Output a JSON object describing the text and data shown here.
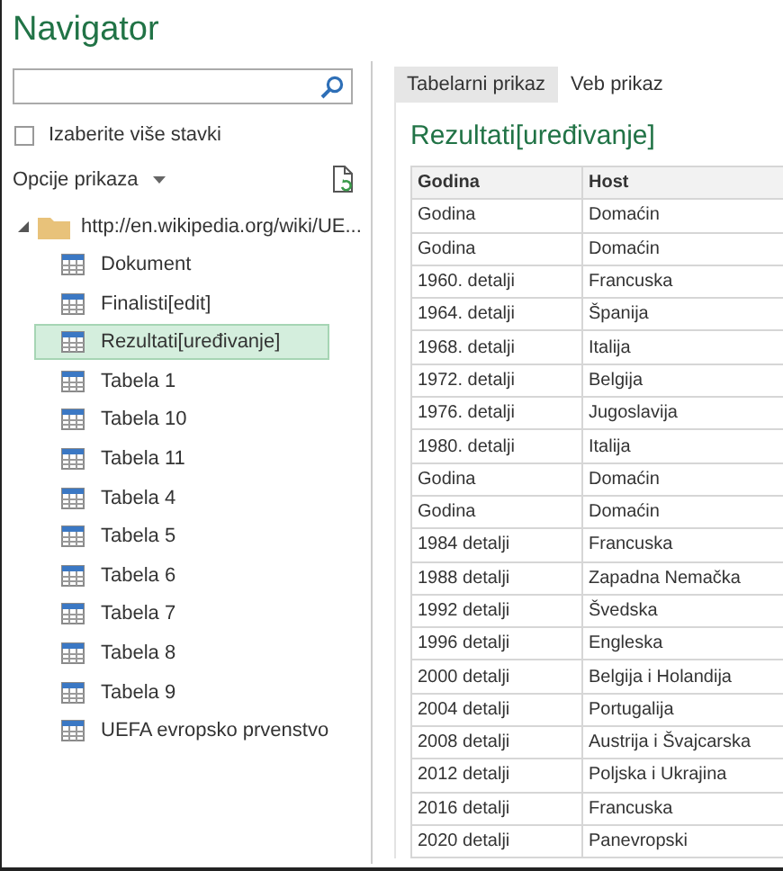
{
  "window": {
    "title": "Navigator"
  },
  "multi_select": {
    "label": "Izaberite više stavki",
    "checked": false
  },
  "view_options": {
    "label": "Opcije prikaza"
  },
  "tree": [
    {
      "label": "http://en.wikipedia.org/wiki/UE...",
      "expanded": true,
      "children": [
        {
          "label": "Dokument",
          "selected": false
        },
        {
          "label": "Finalisti[edit]",
          "selected": false
        },
        {
          "label": "Rezultati[uređivanje]",
          "selected": true
        },
        {
          "label": "Tabela 1",
          "selected": false
        },
        {
          "label": "Tabela 10",
          "selected": false
        },
        {
          "label": "Tabela 11",
          "selected": false
        },
        {
          "label": "Tabela 4",
          "selected": false
        },
        {
          "label": "Tabela 5",
          "selected": false
        },
        {
          "label": "Tabela 6",
          "selected": false
        },
        {
          "label": "Tabela 7",
          "selected": false
        },
        {
          "label": "Tabela 8",
          "selected": false
        },
        {
          "label": "Tabela 9",
          "selected": false
        },
        {
          "label": "UEFA evropsko prvenstvo",
          "selected": false
        }
      ]
    }
  ],
  "tabs": [
    {
      "label": "Tabelarni prikaz",
      "selected": true
    },
    {
      "label": "Veb prikaz",
      "selected": false
    }
  ],
  "preview": {
    "title": "Rezultati[uređivanje]",
    "table": {
      "columns": [
        "Godina",
        "Host"
      ],
      "rows": [
        [
          "Godina",
          "Domaćin"
        ],
        [
          "Godina",
          "Domaćin"
        ],
        [
          "1960. detalji",
          "Francuska"
        ],
        [
          "1964. detalji",
          "Španija"
        ],
        [
          "1968. detalji",
          "Italija"
        ],
        [
          "1972. detalji",
          "Belgija"
        ],
        [
          "1976. detalji",
          "Jugoslavija"
        ],
        [
          "1980. detalji",
          "Italija"
        ],
        [
          "Godina",
          "Domaćin"
        ],
        [
          "Godina",
          "Domaćin"
        ],
        [
          "1984 detalji",
          "Francuska"
        ],
        [
          "1988 detalji",
          "Zapadna Nemačka"
        ],
        [
          "1992 detalji",
          "Švedska"
        ],
        [
          "1996 detalji",
          "Engleska"
        ],
        [
          "2000 detalji",
          "Belgija i Holandija"
        ],
        [
          "2004 detalji",
          "Portugalija"
        ],
        [
          "2008 detalji",
          "Austrija i Švajcarska"
        ],
        [
          "2012 detalji",
          "Poljska i Ukrajina"
        ],
        [
          "2016 detalji",
          "Francuska"
        ],
        [
          "2020 detalji",
          "Panevropski"
        ]
      ]
    }
  }
}
